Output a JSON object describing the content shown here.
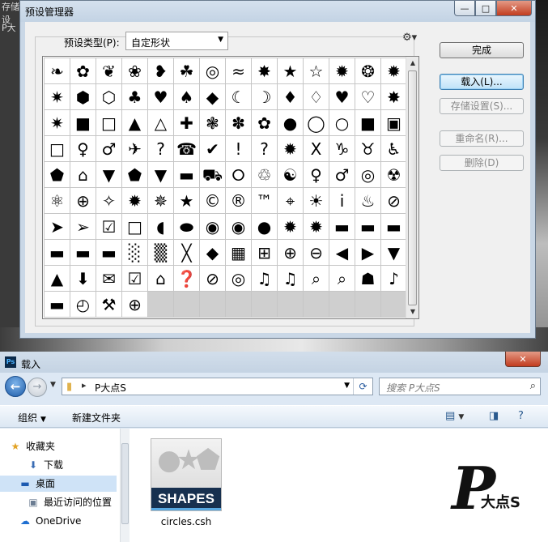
{
  "background": {
    "left_text": [
      "存储设",
      "P大"
    ]
  },
  "preset_manager": {
    "title": "预设管理器",
    "window_controls": {
      "minimize": "—",
      "maximize": "□",
      "close": "✕"
    },
    "type_label": "预设类型(P):",
    "type_value": "自定形状",
    "gear_icon": "⚙▾",
    "shapes": [
      "❧",
      "✿",
      "❦",
      "❀",
      "❥",
      "☘",
      "◎",
      "≈",
      "✸",
      "★",
      "☆",
      "✹",
      "❂",
      "✹",
      "✷",
      "⬢",
      "⬡",
      "♣",
      "♥",
      "♠",
      "◆",
      "☾",
      "☽",
      "♦",
      "♢",
      "♥",
      "♡",
      "✸",
      "✷",
      "■",
      "□",
      "▲",
      "△",
      "✚",
      "❃",
      "✽",
      "✿",
      "●",
      "◯",
      "○",
      "■",
      "▣",
      "□",
      "♀",
      "♂",
      "✈",
      "?",
      "☎",
      "✔",
      "!",
      "?",
      "✹",
      "X",
      "♑",
      "♉",
      "♿",
      "⬟",
      "⌂",
      "▼",
      "⬟",
      "▼",
      "▬",
      "⛟",
      "⭘",
      "♲",
      "☯",
      "♀",
      "♂",
      "◎",
      "☢",
      "⚛",
      "⊕",
      "✧",
      "✹",
      "✵",
      "★",
      "©",
      "®",
      "™",
      "⌖",
      "☀",
      "i",
      "♨",
      "⊘",
      "➤",
      "➢",
      "☑",
      "□",
      "◖",
      "⬬",
      "◉",
      "◉",
      "●",
      "✹",
      "✹",
      "▬",
      "▬",
      "▬",
      "▬",
      "▬",
      "▬",
      "░",
      "▒",
      "╳",
      "◆",
      "▦",
      "⊞",
      "⊕",
      "⊖",
      "◀",
      "▶",
      "▼",
      "▲",
      "⬇",
      "✉",
      "☑",
      "⌂",
      "❓",
      "⊘",
      "◎",
      "♫",
      "♫",
      "⌕",
      "⌕",
      "☗",
      "♪",
      "▬",
      "◴",
      "⚒",
      "⊕",
      ""
    ],
    "buttons": {
      "done": "完成",
      "load": "载入(L)...",
      "save": "存储设置(S)...",
      "rename": "重命名(R)...",
      "delete": "删除(D)"
    }
  },
  "load_dialog": {
    "title": "载入",
    "app_logo": "Ps",
    "close": "✕",
    "address": {
      "path": "P大点S",
      "separator": "▸"
    },
    "search_placeholder": "搜索 P大点S",
    "toolbar": {
      "organize": "组织",
      "new_folder": "新建文件夹"
    },
    "nav": [
      {
        "label": "收藏夹",
        "icon": "star-icon"
      },
      {
        "label": "下载",
        "icon": "download-icon"
      },
      {
        "label": "桌面",
        "icon": "desktop-icon"
      },
      {
        "label": "最近访问的位置",
        "icon": "recent-places-icon"
      },
      {
        "label": "OneDrive",
        "icon": "cloud-icon"
      }
    ],
    "file": {
      "name": "circles.csh",
      "banner": "SHAPES"
    }
  },
  "watermark": {
    "big": "P",
    "small": "大点S"
  }
}
